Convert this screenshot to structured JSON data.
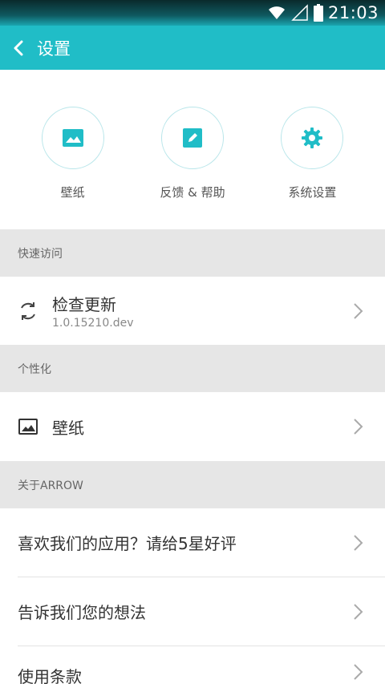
{
  "status_bar": {
    "time": "21:03",
    "icons": [
      "wifi-icon",
      "signal-icon",
      "battery-icon"
    ]
  },
  "app_bar": {
    "title": "设置",
    "back_icon": "chevron-left-icon"
  },
  "quick_actions": [
    {
      "label": "壁纸",
      "icon": "image-icon"
    },
    {
      "label": "反馈 & 帮助",
      "icon": "edit-icon"
    },
    {
      "label": "系统设置",
      "icon": "gear-icon"
    }
  ],
  "sections": {
    "quick_access": {
      "header": "快速访问",
      "item": {
        "title": "检查更新",
        "subtitle": "1.0.15210.dev",
        "icon": "refresh-icon"
      }
    },
    "personalize": {
      "header": "个性化",
      "item": {
        "title": "壁纸",
        "icon": "image-icon"
      }
    },
    "about": {
      "header": "关于ARROW",
      "items": [
        {
          "title": "喜欢我们的应用？请给5星好评"
        },
        {
          "title": "告诉我们您的想法"
        },
        {
          "title": "使用条款"
        }
      ]
    }
  },
  "colors": {
    "accent": "#20bdc7",
    "section_bg": "#e6e6e6"
  }
}
